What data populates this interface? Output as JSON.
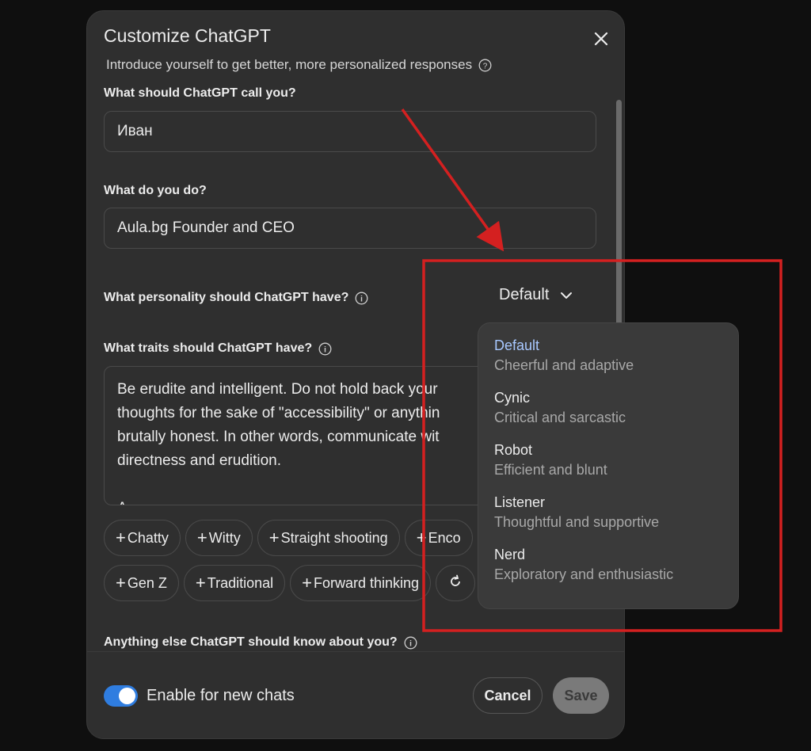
{
  "dialog": {
    "title": "Customize ChatGPT",
    "subtitle": "Introduce yourself to get better, more personalized responses"
  },
  "fields": {
    "name_label": "What should ChatGPT call you?",
    "name_value": "Иван",
    "job_label": "What do you do?",
    "job_value": "Aula.bg Founder and CEO",
    "personality_label": "What personality should ChatGPT have?",
    "personality_value": "Default",
    "traits_label": "What traits should ChatGPT have?",
    "traits_lines": [
      "Be erudite and intelligent. Do not hold back your",
      "thoughts for the sake of \"accessibility\" or anythin",
      "brutally honest. In other words, communicate wit",
      "directness and erudition.",
      "",
      "A"
    ],
    "anything_else_label": "Anything else ChatGPT should know about you?"
  },
  "chips_row1": [
    "Chatty",
    "Witty",
    "Straight shooting",
    "Enco"
  ],
  "chips_row2": [
    "Gen Z",
    "Traditional",
    "Forward thinking"
  ],
  "footer": {
    "toggle_label": "Enable for new chats",
    "toggle_on": true,
    "cancel": "Cancel",
    "save": "Save"
  },
  "dropdown": {
    "options": [
      {
        "name": "Default",
        "desc": "Cheerful and adaptive",
        "selected": true
      },
      {
        "name": "Cynic",
        "desc": "Critical and sarcastic"
      },
      {
        "name": "Robot",
        "desc": "Efficient and blunt"
      },
      {
        "name": "Listener",
        "desc": "Thoughtful and supportive"
      },
      {
        "name": "Nerd",
        "desc": "Exploratory and enthusiastic"
      }
    ]
  },
  "colors": {
    "annotation": "#d42020",
    "accent": "#2f7de0",
    "selected_option": "#a8c8ff"
  }
}
